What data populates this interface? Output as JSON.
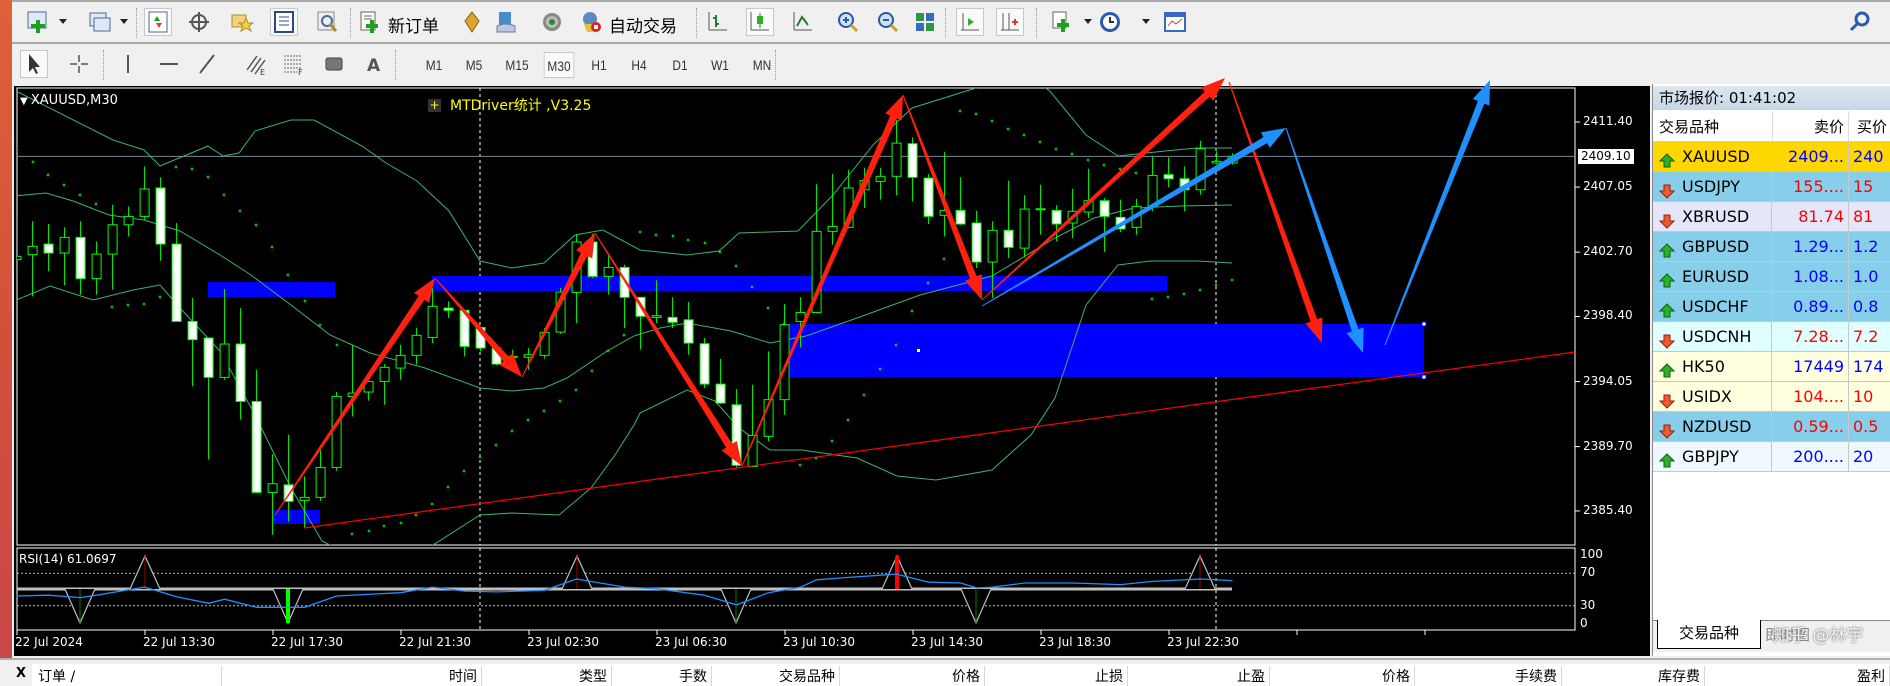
{
  "toolbar": {
    "new_order_label": "新订单",
    "auto_trading_label": "自动交易",
    "periods": [
      "M1",
      "M5",
      "M15",
      "M30",
      "H1",
      "H4",
      "D1",
      "W1",
      "MN"
    ],
    "active_period": "M30"
  },
  "chart": {
    "symbol_label": "XAUUSD,M30",
    "indicator_label": "MTDriver统计 ,V3.25",
    "current_price": "2409.10",
    "price_ticks": [
      "2411.40",
      "2407.05",
      "2402.70",
      "2398.40",
      "2394.05",
      "2389.70",
      "2385.40"
    ],
    "rsi_label": "RSI(14) 61.0697",
    "rsi_levels": [
      "100",
      "70",
      "30",
      "0"
    ],
    "time_labels": [
      "22 Jul 2024",
      "22 Jul 13:30",
      "22 Jul 17:30",
      "22 Jul 21:30",
      "23 Jul 02:30",
      "23 Jul 06:30",
      "23 Jul 10:30",
      "23 Jul 14:30",
      "23 Jul 18:30",
      "23 Jul 22:30"
    ],
    "colors": {
      "bull_outline": "#00ff00",
      "bear_fill": "#ffffff",
      "bands": "#3cb371",
      "zone": "#0000ff",
      "arrow_red": "#ff2010",
      "arrow_blue": "#1e90ff",
      "trendline": "#ff0000",
      "rsi": "#1e90ff"
    }
  },
  "chart_data": {
    "type": "candlestick",
    "symbol": "XAUUSD",
    "timeframe": "M30",
    "ohlc": [
      [
        2402.2,
        2405.43,
        2400.75,
        2402.42
      ],
      [
        2402.53,
        2404.76,
        2399.74,
        2403.09
      ],
      [
        2403.24,
        2404.58,
        2401.42,
        2402.64
      ],
      [
        2402.64,
        2404.36,
        2400.48,
        2403.69
      ],
      [
        2403.69,
        2404.76,
        2399.86,
        2400.93
      ],
      [
        2400.93,
        2403.42,
        2399.86,
        2402.57
      ],
      [
        2402.57,
        2405.87,
        2400.19,
        2404.53
      ],
      [
        2404.53,
        2405.76,
        2403.75,
        2405.09
      ],
      [
        2405.09,
        2408.43,
        2404.87,
        2406.92
      ],
      [
        2406.99,
        2407.7,
        2402.13,
        2403.24
      ],
      [
        2403.24,
        2404.65,
        2398.07,
        2398.07
      ],
      [
        2398.07,
        2399.63,
        2393.73,
        2396.85
      ],
      [
        2396.96,
        2396.96,
        2388.83,
        2394.33
      ],
      [
        2394.33,
        2400.23,
        2394.17,
        2396.56
      ],
      [
        2396.56,
        2398.96,
        2391.5,
        2392.72
      ],
      [
        2392.72,
        2394.84,
        2386.6,
        2386.64
      ],
      [
        2386.64,
        2389.2,
        2383.81,
        2387.22
      ],
      [
        2387.15,
        2390.5,
        2384.7,
        2386.04
      ],
      [
        2386.11,
        2387.71,
        2384.26,
        2386.31
      ],
      [
        2386.31,
        2389.49,
        2386.08,
        2388.31
      ],
      [
        2388.31,
        2393.35,
        2388.09,
        2393.06
      ],
      [
        2393.06,
        2396.51,
        2391.72,
        2393.28
      ],
      [
        2393.35,
        2394.06,
        2392.77,
        2394.06
      ],
      [
        2394.06,
        2395.22,
        2392.5,
        2395.0
      ],
      [
        2394.95,
        2396.51,
        2394.17,
        2395.8
      ],
      [
        2395.8,
        2397.63,
        2395.18,
        2397.14
      ],
      [
        2397.0,
        2400.3,
        2396.62,
        2399.08
      ],
      [
        2398.96,
        2399.41,
        2398.3,
        2398.81
      ],
      [
        2398.81,
        2398.85,
        2395.73,
        2396.4
      ],
      [
        2397.67,
        2397.74,
        2396.07,
        2396.29
      ],
      [
        2396.29,
        2396.51,
        2395.13,
        2395.22
      ],
      [
        2395.67,
        2396.18,
        2394.73,
        2395.73
      ],
      [
        2395.67,
        2396.29,
        2394.84,
        2395.84
      ],
      [
        2395.8,
        2397.63,
        2395.58,
        2397.34
      ],
      [
        2397.36,
        2400.3,
        2397.23,
        2400.03
      ],
      [
        2400.01,
        2403.91,
        2397.96,
        2403.38
      ],
      [
        2403.38,
        2403.91,
        2400.97,
        2401.08
      ],
      [
        2401.08,
        2402.53,
        2399.86,
        2401.68
      ],
      [
        2401.68,
        2401.86,
        2397.63,
        2399.68
      ],
      [
        2399.68,
        2399.68,
        2396.18,
        2398.41
      ],
      [
        2398.34,
        2400.81,
        2397.96,
        2398.45
      ],
      [
        2398.34,
        2399.68,
        2397.63,
        2398.01
      ],
      [
        2398.18,
        2399.37,
        2395.84,
        2396.62
      ],
      [
        2396.58,
        2396.96,
        2393.62,
        2393.88
      ],
      [
        2393.88,
        2395.56,
        2392.55,
        2392.61
      ],
      [
        2392.5,
        2393.55,
        2388.31,
        2388.45
      ],
      [
        2388.38,
        2393.84,
        2388.31,
        2390.45
      ],
      [
        2390.39,
        2396.07,
        2390.05,
        2392.84
      ],
      [
        2392.84,
        2399.23,
        2391.83,
        2397.85
      ],
      [
        2398.07,
        2399.68,
        2396.33,
        2398.67
      ],
      [
        2398.67,
        2407.25,
        2398.63,
        2404.09
      ],
      [
        2404.09,
        2407.92,
        2403.2,
        2404.42
      ],
      [
        2404.36,
        2408.21,
        2404.31,
        2406.99
      ],
      [
        2406.87,
        2408.32,
        2405.65,
        2407.48
      ],
      [
        2407.43,
        2408.32,
        2406.21,
        2407.77
      ],
      [
        2407.77,
        2411.55,
        2406.5,
        2409.99
      ],
      [
        2409.95,
        2410.37,
        2406.09,
        2407.7
      ],
      [
        2407.65,
        2407.92,
        2404.58,
        2405.09
      ],
      [
        2405.16,
        2409.39,
        2403.75,
        2405.49
      ],
      [
        2405.49,
        2407.7,
        2404.53,
        2404.58
      ],
      [
        2404.65,
        2405.47,
        2401.64,
        2402.04
      ],
      [
        2402.04,
        2404.76,
        2399.63,
        2404.16
      ],
      [
        2404.16,
        2407.48,
        2402.31,
        2403.02
      ],
      [
        2402.97,
        2406.5,
        2402.35,
        2405.58
      ],
      [
        2405.58,
        2407.21,
        2403.87,
        2405.6
      ],
      [
        2405.49,
        2405.83,
        2403.42,
        2404.58
      ],
      [
        2404.65,
        2406.94,
        2403.64,
        2405.43
      ],
      [
        2405.38,
        2408.28,
        2404.98,
        2406.14
      ],
      [
        2406.14,
        2406.32,
        2402.71,
        2405.09
      ],
      [
        2405.03,
        2406.21,
        2404.04,
        2404.25
      ],
      [
        2404.36,
        2406.27,
        2403.87,
        2405.76
      ],
      [
        2405.76,
        2409.1,
        2405.43,
        2407.83
      ],
      [
        2407.88,
        2409.04,
        2407.03,
        2407.61
      ],
      [
        2407.61,
        2408.43,
        2405.43,
        2406.87
      ],
      [
        2406.87,
        2410.15,
        2406.54,
        2409.61
      ],
      [
        2408.66,
        2409.44,
        2408.55,
        2408.77
      ],
      [
        2408.66,
        2409.32,
        2408.55,
        2409.1
      ]
    ],
    "rsi_points": [
      [
        0,
        42
      ],
      [
        2,
        43
      ],
      [
        4,
        40
      ],
      [
        5,
        43
      ],
      [
        8,
        53
      ],
      [
        10,
        41
      ],
      [
        12,
        33
      ],
      [
        13,
        38
      ],
      [
        15,
        28
      ],
      [
        18,
        28
      ],
      [
        20,
        42
      ],
      [
        24,
        46
      ],
      [
        26,
        53
      ],
      [
        28,
        48
      ],
      [
        30,
        47
      ],
      [
        33,
        49
      ],
      [
        35,
        63
      ],
      [
        38,
        53
      ],
      [
        40,
        51
      ],
      [
        43,
        43
      ],
      [
        45,
        31
      ],
      [
        47,
        46
      ],
      [
        49,
        53
      ],
      [
        50,
        62
      ],
      [
        52,
        65
      ],
      [
        55,
        69
      ],
      [
        57,
        59
      ],
      [
        59,
        58
      ],
      [
        60,
        52
      ],
      [
        61,
        53
      ],
      [
        63,
        58
      ],
      [
        66,
        58
      ],
      [
        69,
        56
      ],
      [
        71,
        60
      ],
      [
        74,
        63
      ],
      [
        76,
        61
      ]
    ],
    "rsi_levels": [
      70,
      30
    ],
    "ylim": [
      2383.0,
      2413.0
    ]
  },
  "market_watch": {
    "title": "市场报价: 01:41:02",
    "columns": [
      "交易品种",
      "卖价",
      "买价"
    ],
    "rows": [
      {
        "symbol": "XAUUSD",
        "bid": "2409...",
        "ask": "240",
        "dir": "up",
        "bg": "#ffd700"
      },
      {
        "symbol": "USDJPY",
        "bid": "155....",
        "ask": "15",
        "dir": "down",
        "bg": "#87ceeb"
      },
      {
        "symbol": "XBRUSD",
        "bid": "81.74",
        "ask": "81",
        "dir": "down",
        "bg": "#e6e6fa"
      },
      {
        "symbol": "GBPUSD",
        "bid": "1.29...",
        "ask": "1.2",
        "dir": "up",
        "bg": "#87ceeb"
      },
      {
        "symbol": "EURUSD",
        "bid": "1.08...",
        "ask": "1.0",
        "dir": "up",
        "bg": "#87ceeb"
      },
      {
        "symbol": "USDCHF",
        "bid": "0.89...",
        "ask": "0.8",
        "dir": "up",
        "bg": "#87ceeb"
      },
      {
        "symbol": "USDCNH",
        "bid": "7.28...",
        "ask": "7.2",
        "dir": "down",
        "bg": "#e0ffff"
      },
      {
        "symbol": "HK50",
        "bid": "17449",
        "ask": "174",
        "dir": "up",
        "bg": "#ffffe0"
      },
      {
        "symbol": "USIDX",
        "bid": "104....",
        "ask": "10",
        "dir": "down",
        "bg": "#ffffe0"
      },
      {
        "symbol": "NZDUSD",
        "bid": "0.59...",
        "ask": "0.5",
        "dir": "down",
        "bg": "#87ceeb"
      },
      {
        "symbol": "GBPJPY",
        "bid": "200....",
        "ask": "20",
        "dir": "up",
        "bg": "#f0f8ff"
      }
    ],
    "tabs": [
      "交易品种",
      "即时图"
    ],
    "watermark": "知乎 @林宇"
  },
  "terminal": {
    "close_label": "X",
    "columns": [
      "订单 /",
      "时间",
      "类型",
      "手数",
      "交易品种",
      "价格",
      "止损",
      "止盈",
      "价格",
      "手续费",
      "库存费",
      "盈利"
    ]
  }
}
